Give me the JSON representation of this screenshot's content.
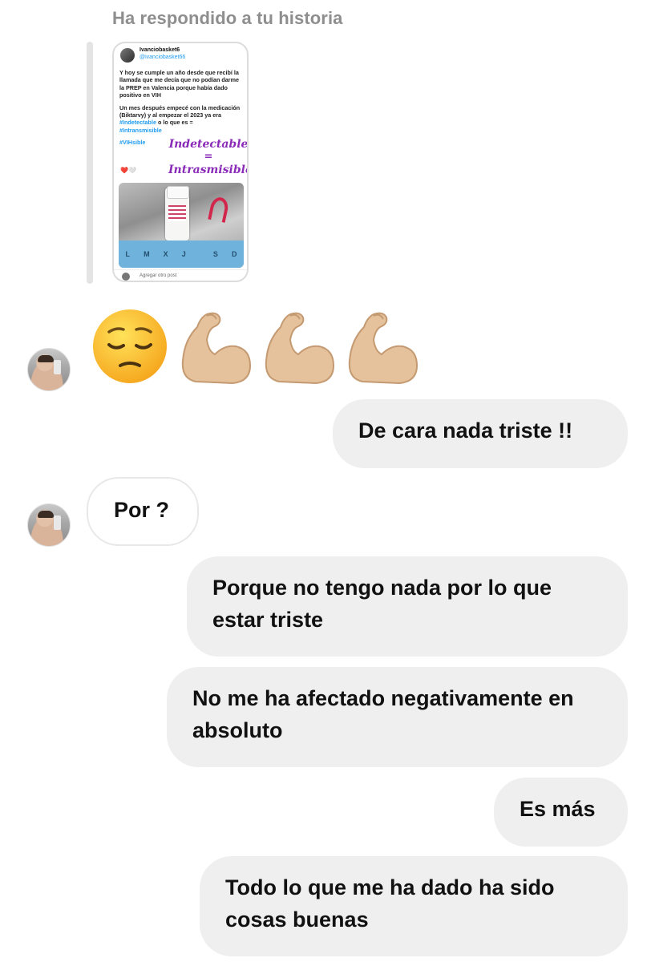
{
  "reply_header": "Ha respondido a tu historia",
  "story": {
    "author_name": "Ivanciobasket6",
    "author_handle": "@ivanciobasket66",
    "paragraph1": "Y hoy se cumple un año desde que recibí la llamada que me decía que no podían darme la PREP en Valencia porque había dado positivo en VIH",
    "paragraph2_prefix": "Un mes después empecé con la medicación (Biktarvy) y al empezar el 2023 ya era",
    "hashtag1": "#Indetectable",
    "paragraph2_middle": "o lo que es =",
    "hashtag2": "#Intransmisible",
    "hashtag3": "#VIHsible",
    "hearts": "❤️🤍",
    "sticker_line1": "Indetectable",
    "sticker_eq": "=",
    "sticker_line2": "Intrasmisible",
    "pillbox_letters": [
      "L",
      "M",
      "X",
      "J",
      "",
      "S",
      "D"
    ],
    "footer": "Agregar otro post"
  },
  "emoji_reaction": [
    "pensive-face",
    "flexed-biceps",
    "flexed-biceps",
    "flexed-biceps"
  ],
  "messages": [
    {
      "direction": "outgoing",
      "text": "De cara nada triste !!"
    },
    {
      "direction": "incoming",
      "text": "Por ?"
    },
    {
      "direction": "outgoing",
      "text": "Porque no tengo nada por lo que estar triste"
    },
    {
      "direction": "outgoing",
      "text": "No me ha afectado negativamente en absoluto"
    },
    {
      "direction": "outgoing",
      "text": "Es más"
    },
    {
      "direction": "outgoing",
      "text": "Todo lo que me ha dado ha sido cosas buenas"
    }
  ],
  "colors": {
    "outgoing_bubble": "#efefef",
    "incoming_border": "#e8e8e8",
    "header_text": "#8e8e8e",
    "hashtag": "#1d9bf0",
    "sticker": "#8a2bb8"
  }
}
